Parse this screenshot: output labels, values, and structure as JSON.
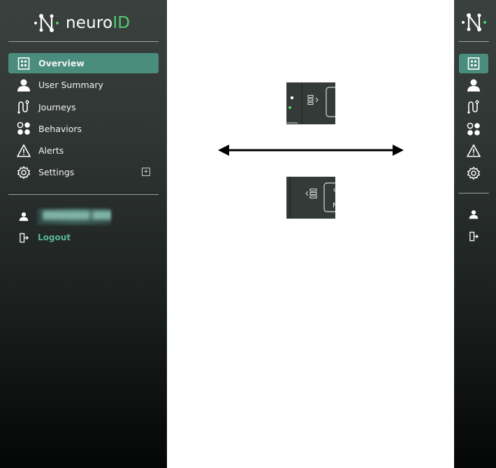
{
  "brand": {
    "name_prefix": "neuro",
    "name_suffix": "ID",
    "logo_icon": "neuroid-logo-icon",
    "accent_color": "#4fd070"
  },
  "sidebar": {
    "background_top": "#3a413f",
    "active_color": "#4a8d7e",
    "items": [
      {
        "label": "Overview",
        "icon": "dashboard-icon",
        "active": true
      },
      {
        "label": "User Summary",
        "icon": "user-icon",
        "active": false
      },
      {
        "label": "Journeys",
        "icon": "journey-path-icon",
        "active": false
      },
      {
        "label": "Behaviors",
        "icon": "behaviors-dots-icon",
        "active": false
      },
      {
        "label": "Alerts",
        "icon": "alert-triangle-icon",
        "active": false
      },
      {
        "label": "Settings",
        "icon": "gear-icon",
        "active": false,
        "expand_icon": "plus-box-icon"
      }
    ],
    "user": {
      "icon": "user-icon",
      "name": "(blurred)"
    },
    "logout": {
      "label": "Logout",
      "icon": "logout-door-icon",
      "color": "#58b597"
    }
  },
  "illustration": {
    "arrow": "double-headed-arrow",
    "toggle_expand_icon": "expand-sidebar-icon",
    "toggle_collapse_icon": "collapse-sidebar-icon",
    "partial_letter": "N"
  }
}
